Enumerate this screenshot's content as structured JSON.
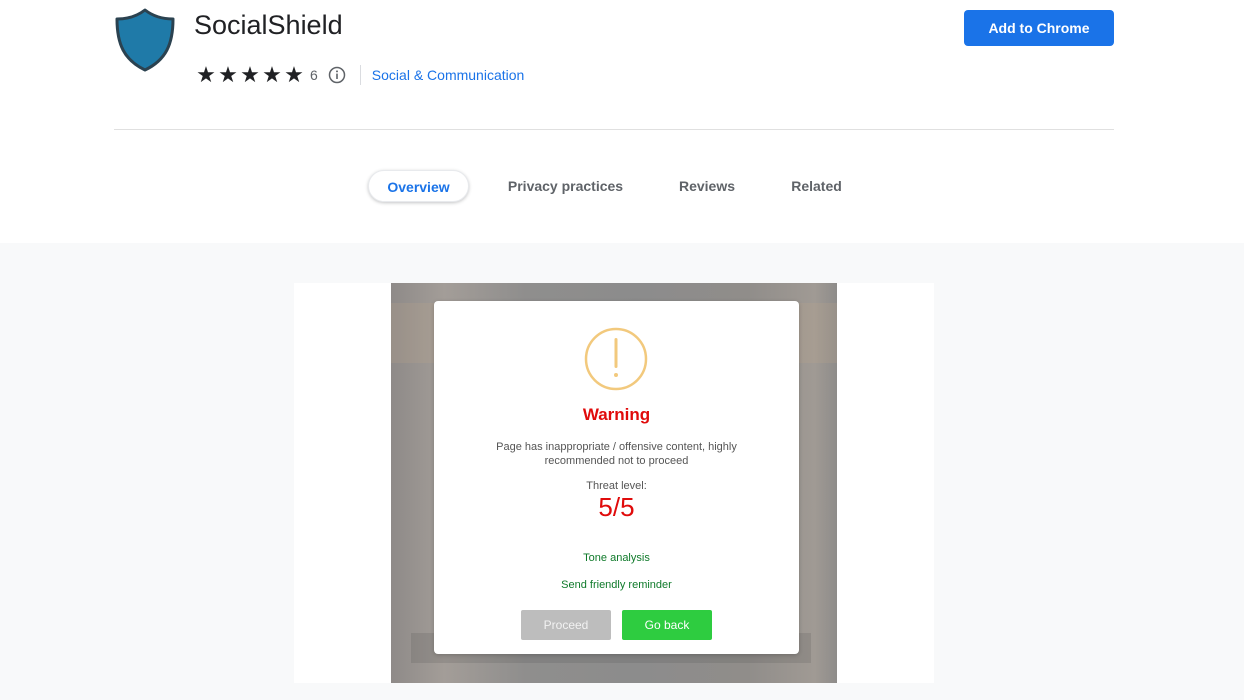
{
  "extension": {
    "title": "SocialShield",
    "rating_stars": 5,
    "rating_count": "6",
    "category": "Social & Communication",
    "icon": "shield-icon",
    "icon_color": "#1f7aa8"
  },
  "header": {
    "add_button_label": "Add to Chrome",
    "accent_color": "#1a73e8"
  },
  "tabs": [
    {
      "label": "Overview",
      "active": true
    },
    {
      "label": "Privacy practices",
      "active": false
    },
    {
      "label": "Reviews",
      "active": false
    },
    {
      "label": "Related",
      "active": false
    }
  ],
  "screenshot_dialog": {
    "icon": "exclamation-circle-icon",
    "title": "Warning",
    "message": "Page has inappropriate / offensive content, highly recommended not to proceed",
    "threat_label": "Threat level:",
    "threat_value": "5/5",
    "tone_link": "Tone analysis",
    "reminder_link": "Send friendly reminder",
    "proceed_label": "Proceed",
    "back_label": "Go back",
    "warning_color": "#e00b0b",
    "proceed_color": "#bdbdbd",
    "back_color": "#2ecc40"
  }
}
